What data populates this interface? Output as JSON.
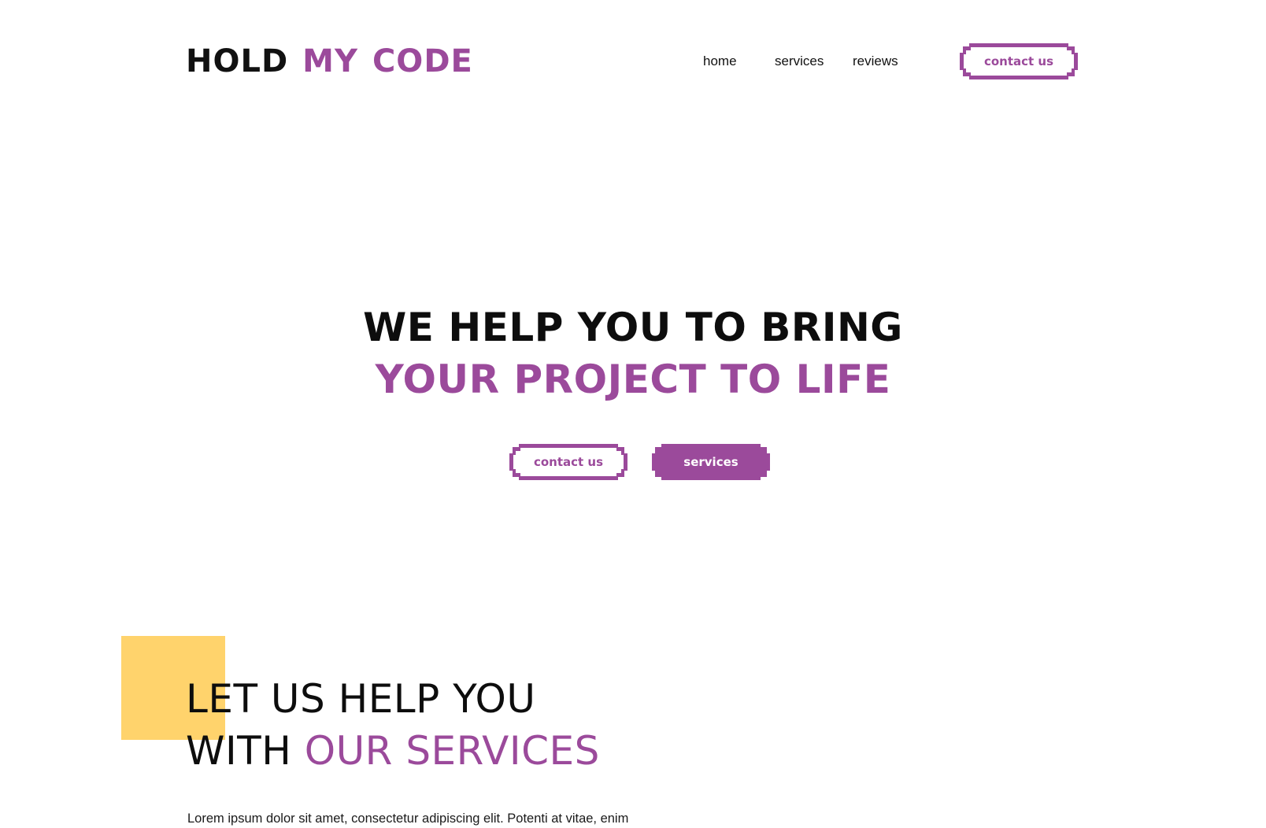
{
  "brand": {
    "word1": "HOLD",
    "word2": "MY",
    "word3": "CODE"
  },
  "nav": {
    "items": [
      {
        "label": "home"
      },
      {
        "label": "services"
      },
      {
        "label": "reviews"
      }
    ],
    "contact_label": "contact us"
  },
  "hero": {
    "line1": "WE HELP YOU TO BRING",
    "line2": "YOUR PROJECT TO LIFE",
    "contact_label": "contact us",
    "services_label": "services"
  },
  "services_section": {
    "title_line1": "LET US HELP YOU",
    "title_line2_plain": "WITH",
    "title_line2_accent": "OUR SERVICES",
    "body": "Lorem ipsum dolor sit amet, consectetur adipiscing elit. Potenti at vitae, enim"
  },
  "colors": {
    "accent": "#9b4a9b",
    "highlight": "#ffd36c",
    "text": "#111111",
    "background": "#ffffff"
  }
}
